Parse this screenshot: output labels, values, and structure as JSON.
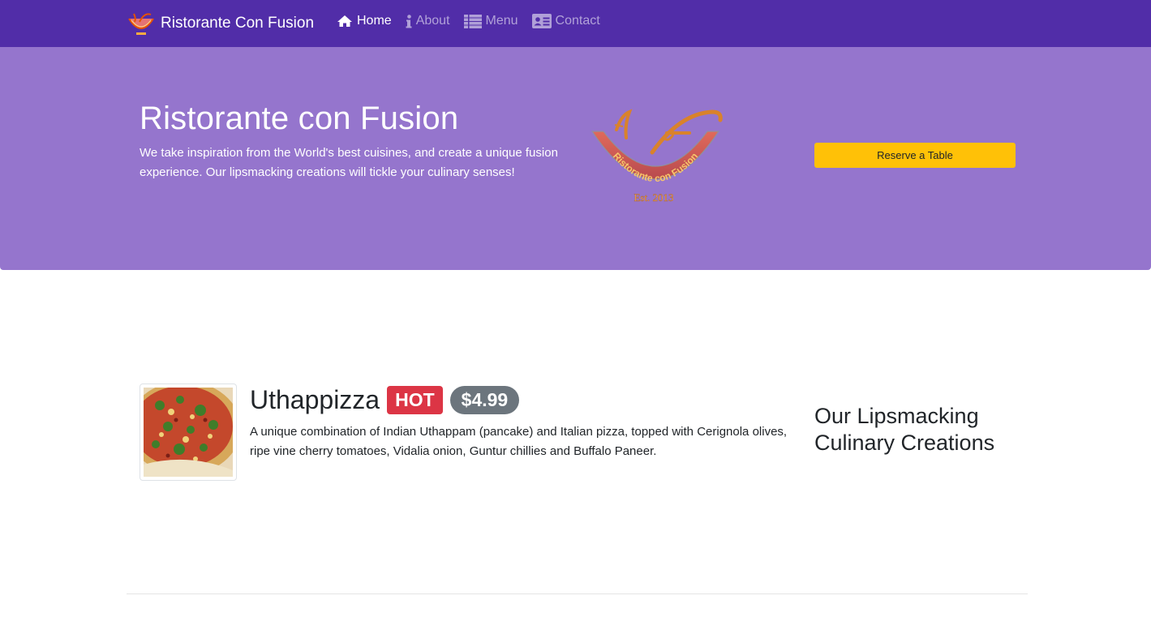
{
  "navbar": {
    "brand_text": "Ristorante Con Fusion",
    "brand_logo_icon": "restaurant-logo",
    "items": [
      {
        "label": "Home",
        "icon": "home-icon",
        "active": true
      },
      {
        "label": "About",
        "icon": "info-icon",
        "active": false
      },
      {
        "label": "Menu",
        "icon": "list-icon",
        "active": false
      },
      {
        "label": "Contact",
        "icon": "address-card-icon",
        "active": false
      }
    ],
    "bg_color": "#512da8"
  },
  "jumbotron": {
    "title": "Ristorante con Fusion",
    "text": "We take inspiration from the World's best cuisines, and create a unique fusion experience. Our lipsmacking creations will tickle your culinary senses!",
    "logo_text": "Ristorante con Fusion",
    "logo_est": "Est. 2013",
    "reserve_label": "Reserve a Table",
    "bg_color": "#9575cd",
    "button_color": "#ffc107"
  },
  "featured": {
    "name": "Uthappizza",
    "badge": "HOT",
    "price": "$4.99",
    "description": "A unique combination of Indian Uthappam (pancake) and Italian pizza, topped with Cerignola olives, ripe vine cherry tomatoes, Vidalia onion, Guntur chillies and Buffalo Paneer.",
    "image_icon": "pizza-image"
  },
  "side": {
    "title": "Our Lipsmacking Culinary Creations"
  }
}
